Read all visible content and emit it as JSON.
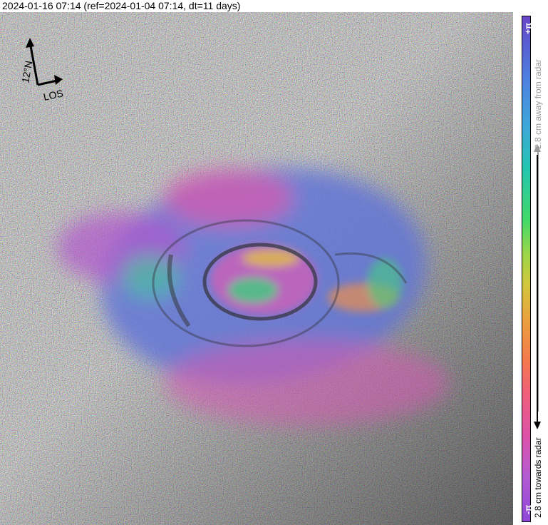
{
  "header": {
    "title": "2024-01-16 07:14 (ref=2024-01-04 07:14, dt=11 days)"
  },
  "compass": {
    "north_label": "12°N",
    "los_label": "LOS"
  },
  "colorbar": {
    "top_label": "+π",
    "bottom_label": "-π",
    "away_label": "2.8 cm away from radar",
    "towards_label": "2.8 cm towards radar"
  },
  "colors": {
    "crater_blue": "#5a6fd8",
    "fringe_magenta": "#d452b0",
    "fringe_green": "#36d07a",
    "fringe_orange": "#f08a42",
    "terrain_dark": "#4a4a4a"
  }
}
